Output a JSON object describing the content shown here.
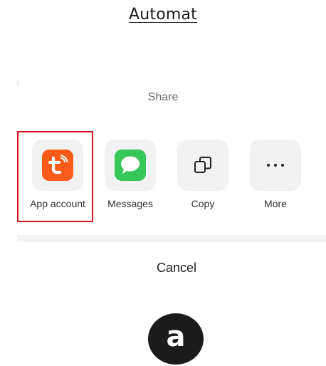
{
  "page_title": "Automat",
  "share_sheet": {
    "title": "Share",
    "targets": [
      {
        "label": "App account",
        "icon": "tuya-app-icon",
        "color": "#fb5b18"
      },
      {
        "label": "Messages",
        "icon": "messages-icon",
        "color": "#37c759"
      },
      {
        "label": "Copy",
        "icon": "copy-icon"
      },
      {
        "label": "More",
        "icon": "more-dots-icon"
      }
    ],
    "cancel_label": "Cancel"
  },
  "highlight_color": "#d0141e",
  "step_badge": "a"
}
